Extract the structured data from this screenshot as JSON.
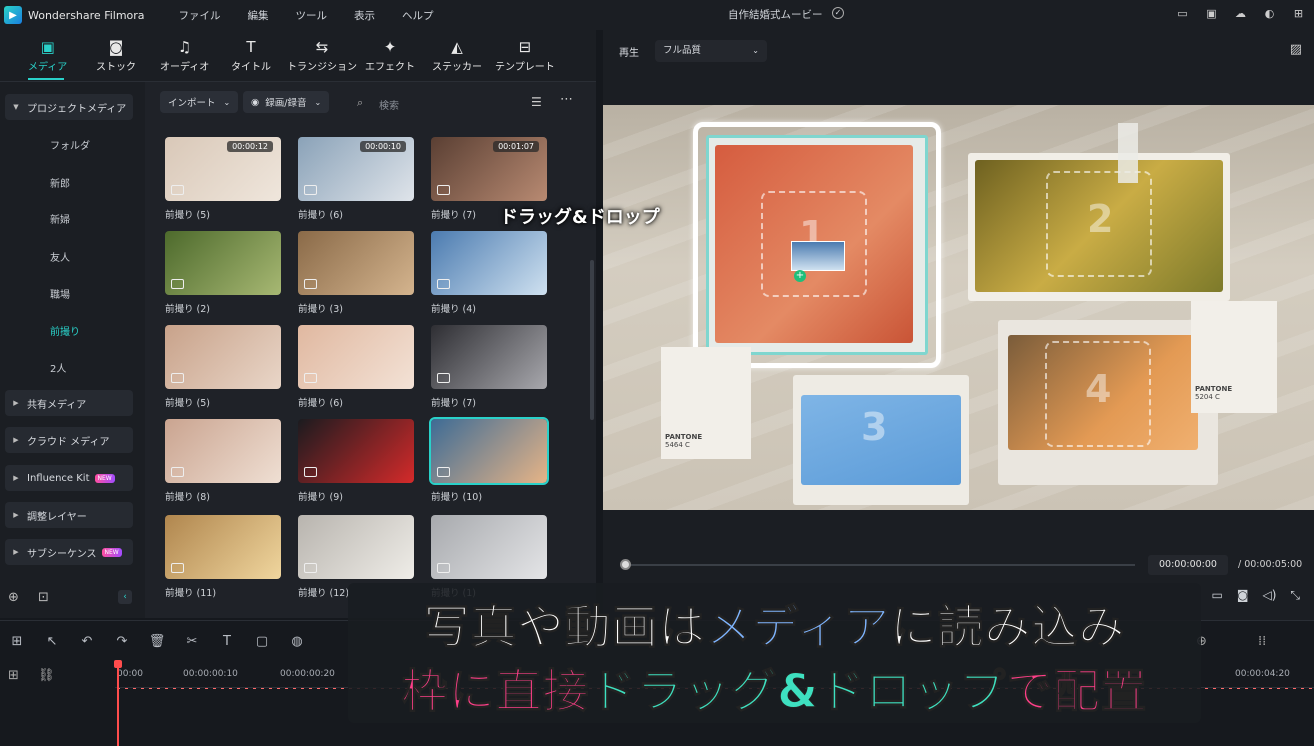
{
  "app": {
    "title": "Wondershare Filmora",
    "document": "自作結婚式ムービー"
  },
  "menu": [
    "ファイル",
    "編集",
    "ツール",
    "表示",
    "ヘルプ"
  ],
  "toolbar": [
    "メディア",
    "ストック",
    "オーディオ",
    "タイトル",
    "トランジション",
    "エフェクト",
    "ステッカー",
    "テンプレート"
  ],
  "sidebar": {
    "project_media": "プロジェクトメディア",
    "subfolders": [
      "フォルダ",
      "新郎",
      "新婦",
      "友人",
      "職場",
      "前撮り",
      "2人"
    ],
    "sections": [
      {
        "label": "共有メディア",
        "new": false
      },
      {
        "label": "クラウド メディア",
        "new": false
      },
      {
        "label": "Influence Kit",
        "new": true
      },
      {
        "label": "調整レイヤー",
        "new": false
      },
      {
        "label": "サブシーケンス",
        "new": true
      }
    ],
    "new_badge": "NEW"
  },
  "media_toolbar": {
    "import": "インポート",
    "record": "録画/録音",
    "search_placeholder": "検索"
  },
  "media_items": [
    {
      "label": "前撮り (5)",
      "duration": "00:00:12",
      "c1": "#d9c8b8",
      "c2": "#efe6dc"
    },
    {
      "label": "前撮り (6)",
      "duration": "00:00:10",
      "c1": "#8aa2b8",
      "c2": "#dfe4ea"
    },
    {
      "label": "前撮り (7)",
      "duration": "00:01:07",
      "c1": "#5a3f33",
      "c2": "#b88a72"
    },
    {
      "label": "前撮り (2)",
      "duration": "",
      "c1": "#4d6a2c",
      "c2": "#a7b873"
    },
    {
      "label": "前撮り (3)",
      "duration": "",
      "c1": "#8a6a48",
      "c2": "#d4b48e"
    },
    {
      "label": "前撮り (4)",
      "duration": "",
      "c1": "#4b7bb0",
      "c2": "#cfe1f0"
    },
    {
      "label": "前撮り (5)",
      "duration": "",
      "c1": "#c8a28a",
      "c2": "#e9d6c8"
    },
    {
      "label": "前撮り (6)",
      "duration": "",
      "c1": "#e0b8a0",
      "c2": "#f3e2d6"
    },
    {
      "label": "前撮り (7)",
      "duration": "",
      "c1": "#2e2e33",
      "c2": "#a8a8ad"
    },
    {
      "label": "前撮り (8)",
      "duration": "",
      "c1": "#caa490",
      "c2": "#efdfd3"
    },
    {
      "label": "前撮り (9)",
      "duration": "",
      "c1": "#1b1b1f",
      "c2": "#d42a2a"
    },
    {
      "label": "前撮り (10)",
      "duration": "",
      "c1": "#3d6b95",
      "c2": "#e6b487"
    },
    {
      "label": "前撮り (11)",
      "duration": "",
      "c1": "#b0864e",
      "c2": "#f0d69e"
    },
    {
      "label": "前撮り (12)",
      "duration": "",
      "c1": "#b8b4ae",
      "c2": "#efede8"
    },
    {
      "label": "前撮り (1)",
      "duration": "",
      "c1": "#a7a9ad",
      "c2": "#e4e5e7"
    }
  ],
  "preview": {
    "mode": "再生",
    "quality": "フル品質",
    "current_time": "00:00:00:00",
    "total_time": "/ 00:00:05:00",
    "drag_label": "ドラッグ&ドロップ",
    "frame_numbers": [
      "1",
      "2",
      "3",
      "4"
    ],
    "pantone_a": "PANTONE",
    "pantone_a_code": "5464 C",
    "pantone_b": "PANTONE",
    "pantone_b_code": "5204 C"
  },
  "timeline": {
    "ticks": [
      "00:00",
      "00:00:00:10",
      "00:00:00:20",
      "00:00:04:20"
    ]
  },
  "caption": {
    "line1_a": "写真や動画は",
    "line1_b": "メディア",
    "line1_c": "に読み込み",
    "line2_a": "枠に直接",
    "line2_b": "ドラッグ&ドロップ",
    "line2_c": "で配置"
  },
  "colors": {
    "accent": "#2ad1c9",
    "caption_blue": "#7fb5ff",
    "caption_pink": "#ff3f8a",
    "caption_green": "#3ee0c0"
  }
}
